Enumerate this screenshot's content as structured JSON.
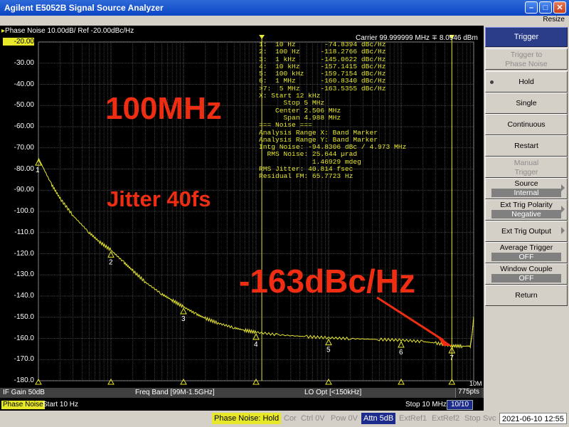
{
  "window": {
    "title": "Agilent E5052B Signal Source Analyzer",
    "menu_right": "Resize"
  },
  "plot": {
    "header": "Phase Noise 10.00dB/ Ref -20.00dBc/Hz",
    "carrier": "Carrier 99.999999 MHz  ∓  8.0946 dBm",
    "y_tick_labels": [
      "-20.00",
      "-30.00",
      "-40.00",
      "-50.00",
      "-60.00",
      "-70.00",
      "-80.00",
      "-90.00",
      "-100.0",
      "-110.0",
      "-120.0",
      "-130.0",
      "-140.0",
      "-150.0",
      "-160.0",
      "-170.0",
      "-180.0"
    ],
    "x_edge_label": "10M",
    "marker_labels": [
      "1",
      "2",
      "3",
      "4",
      "5",
      "6",
      "7"
    ],
    "trace_color": "#e8e82a",
    "info_lines": [
      "1:  10 Hz       -74.8394 dBc/Hz",
      "2:  100 Hz     -118.2766 dBc/Hz",
      "3:  1 kHz      -145.0622 dBc/Hz",
      "4:  10 kHz     -157.1415 dBc/Hz",
      "5:  100 kHz    -159.7154 dBc/Hz",
      "6:  1 MHz      -160.8340 dBc/Hz",
      ">7:  5 MHz     -163.5355 dBc/Hz",
      "X: Start 12 kHz",
      "      Stop 5 MHz",
      "    Center 2.506 MHz",
      "      Span 4.988 MHz",
      "=== Noise ===",
      "Analysis Range X: Band Marker",
      "Analysis Range Y: Band Marker",
      "Intg Noise: -94.8306 dBc / 4.973 MHz",
      "  RMS Noise: 25.644 µrad",
      "             1.46929 mdeg",
      "RMS Jitter: 40.814 fsec",
      "Residual FM: 65.7723 Hz"
    ],
    "annotations": {
      "freq": "100MHz",
      "jitter": "Jitter 40fs",
      "noise": "-163dBc/Hz",
      "color": "#ee2d12"
    }
  },
  "chart_data": {
    "type": "line",
    "title": "Phase Noise 10.00dB/ Ref -20.00dBc/Hz",
    "xlabel": "",
    "ylabel": "",
    "x_scale": "log",
    "xlim": [
      10,
      10000000
    ],
    "ylim": [
      -180,
      -20
    ],
    "x_start_label": "Start 10 Hz",
    "x_stop_label": "Stop 10 MHz",
    "grid": true,
    "series": [
      {
        "values_x": [
          10,
          15,
          20,
          30,
          50,
          70,
          100,
          150,
          200,
          300,
          500,
          700,
          1000,
          1500,
          2000,
          3000,
          5000,
          7000,
          10000,
          20000,
          50000,
          100000,
          200000,
          500000,
          1000000,
          2000000,
          3000000,
          5000000,
          7000000,
          9000000,
          9500000,
          10000000
        ],
        "values_y": [
          -74.8,
          -87,
          -94,
          -102,
          -110,
          -114.5,
          -118.3,
          -124,
          -128,
          -133.5,
          -139,
          -142,
          -145.1,
          -148.5,
          -150.5,
          -152.8,
          -155,
          -156.2,
          -157.1,
          -158.3,
          -159.2,
          -159.7,
          -160.1,
          -160.5,
          -160.8,
          -161.5,
          -162.2,
          -163.5,
          -163.7,
          -163.6,
          -158,
          -150
        ]
      }
    ],
    "markers": [
      {
        "label": "1",
        "x": 10,
        "y": -74.8394
      },
      {
        "label": "2",
        "x": 100,
        "y": -118.2766
      },
      {
        "label": "3",
        "x": 1000,
        "y": -145.0622
      },
      {
        "label": "4",
        "x": 10000,
        "y": -157.1415
      },
      {
        "label": "5",
        "x": 100000,
        "y": -159.7154
      },
      {
        "label": "6",
        "x": 1000000,
        "y": -160.834
      },
      {
        "label": "7",
        "x": 5000000,
        "y": -163.5355
      }
    ],
    "band_x": [
      12000,
      5000000
    ]
  },
  "status1": {
    "if_gain": "IF Gain 50dB",
    "freq_band": "Freq Band [99M-1.5GHz]",
    "lo_opt": "LO Opt [<150kHz]",
    "pts": "775pts"
  },
  "status2": {
    "label": "Phase Noise",
    "start": "Start 10 Hz",
    "stop": "Stop 10 MHz",
    "count": "10/10"
  },
  "softkeys": {
    "header": "Trigger",
    "trigger_to": [
      "Trigger to",
      "Phase Noise"
    ],
    "hold": "Hold",
    "single": "Single",
    "continuous": "Continuous",
    "restart": "Restart",
    "manual": [
      "Manual",
      "Trigger"
    ],
    "source": [
      "Source",
      "Internal"
    ],
    "ext_polarity": [
      "Ext Trig Polarity",
      "Negative"
    ],
    "ext_output": "Ext Trig Output",
    "avg_trigger": [
      "Average Trigger",
      "OFF"
    ],
    "window_couple": [
      "Window Couple",
      "OFF"
    ],
    "return": "Return"
  },
  "bottom": {
    "mode": "Phase Noise: Hold",
    "cor": "Cor",
    "ctrl": "Ctrl  0V",
    "pow": "Pow  0V",
    "attn": "Attn 5dB",
    "extref1": "ExtRef1",
    "extref2": "ExtRef2",
    "stop": "Stop",
    "svc": "Svc",
    "datetime": "2021-06-10 12:55"
  }
}
